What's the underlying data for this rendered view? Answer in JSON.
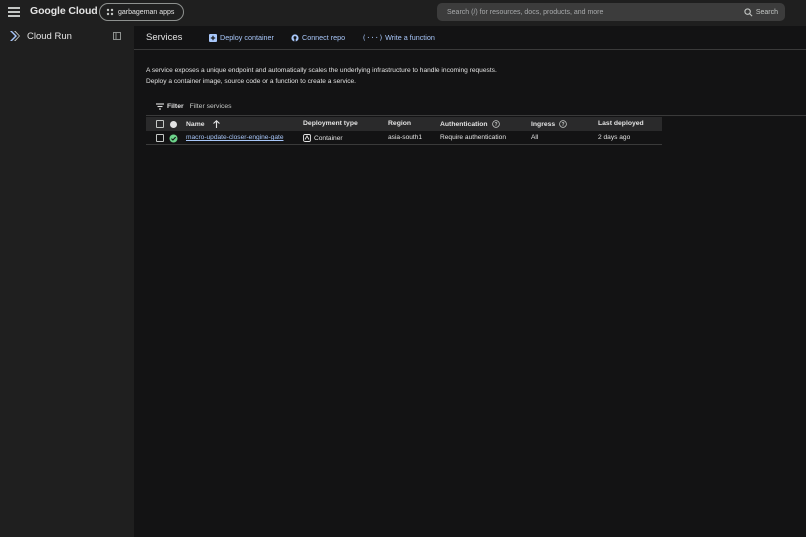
{
  "header": {
    "logo": "Google Cloud",
    "project": "garbageman apps",
    "search_placeholder": "Search (/) for resources, docs, products, and more",
    "search_button": "Search"
  },
  "sidebar": {
    "product": "Cloud Run"
  },
  "page": {
    "title": "Services",
    "actions": [
      "Deploy container",
      "Connect repo",
      "Write a function"
    ],
    "description_line1": "A service exposes a unique endpoint and automatically scales the underlying infrastructure to handle incoming requests.",
    "description_line2": "Deploy a container image, source code or a function to create a service."
  },
  "filter": {
    "label": "Filter",
    "placeholder": "Filter services"
  },
  "table": {
    "headers": {
      "name": "Name",
      "deployment_type": "Deployment type",
      "region": "Region",
      "authentication": "Authentication",
      "ingress": "Ingress",
      "last_deployed": "Last deployed"
    },
    "rows": [
      {
        "name": "macro-update-closer-engine-gate",
        "deployment_type": "Container",
        "region": "asia-south1",
        "authentication": "Require authentication",
        "ingress": "All",
        "last_deployed": "2 days ago",
        "status": "ok"
      }
    ]
  },
  "colors": {
    "accent": "#a8c7fa",
    "status_ok": "#6dd58c"
  }
}
